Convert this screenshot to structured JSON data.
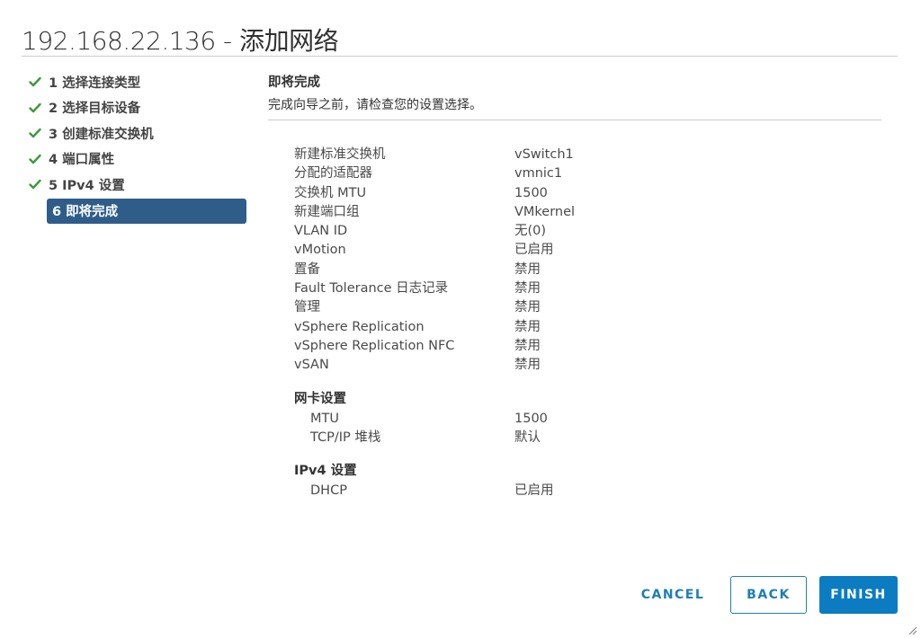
{
  "window": {
    "title": "192.168.22.136 - 添加网络"
  },
  "steps": [
    {
      "label": "1 选择连接类型",
      "done": true
    },
    {
      "label": "2 选择目标设备",
      "done": true
    },
    {
      "label": "3 创建标准交换机",
      "done": true
    },
    {
      "label": "4 端口属性",
      "done": true
    },
    {
      "label": "5 IPv4 设置",
      "done": true
    },
    {
      "label": "6 即将完成",
      "current": true
    }
  ],
  "content": {
    "title": "即将完成",
    "description": "完成向导之前，请检查您的设置选择。"
  },
  "summary": {
    "rows": [
      {
        "key": "新建标准交换机",
        "value": "vSwitch1"
      },
      {
        "key": "分配的适配器",
        "value": "vmnic1"
      },
      {
        "key": "交换机 MTU",
        "value": "1500"
      },
      {
        "key": "新建端口组",
        "value": "VMkernel"
      },
      {
        "key": "VLAN ID",
        "value": "无(0)"
      },
      {
        "key": "vMotion",
        "value": "已启用"
      },
      {
        "key": "置备",
        "value": "禁用"
      },
      {
        "key": "Fault Tolerance 日志记录",
        "value": "禁用"
      },
      {
        "key": "管理",
        "value": "禁用"
      },
      {
        "key": "vSphere Replication",
        "value": "禁用"
      },
      {
        "key": "vSphere Replication NFC",
        "value": "禁用"
      },
      {
        "key": "vSAN",
        "value": "禁用"
      }
    ],
    "nic_section": {
      "title": "网卡设置",
      "rows": [
        {
          "key": "MTU",
          "value": "1500"
        },
        {
          "key": "TCP/IP 堆栈",
          "value": "默认"
        }
      ]
    },
    "ipv4_section": {
      "title": "IPv4 设置",
      "rows": [
        {
          "key": "DHCP",
          "value": "已启用"
        }
      ]
    }
  },
  "buttons": {
    "cancel": "CANCEL",
    "back": "BACK",
    "finish": "FINISH"
  },
  "icons": {
    "step_done": "check-icon",
    "resize": "resize-grip-icon"
  },
  "colors": {
    "check": "#3a9a3a",
    "current_step_bg": "#2f5d89",
    "primary": "#0b7cc1",
    "link": "#1e7fb5"
  }
}
